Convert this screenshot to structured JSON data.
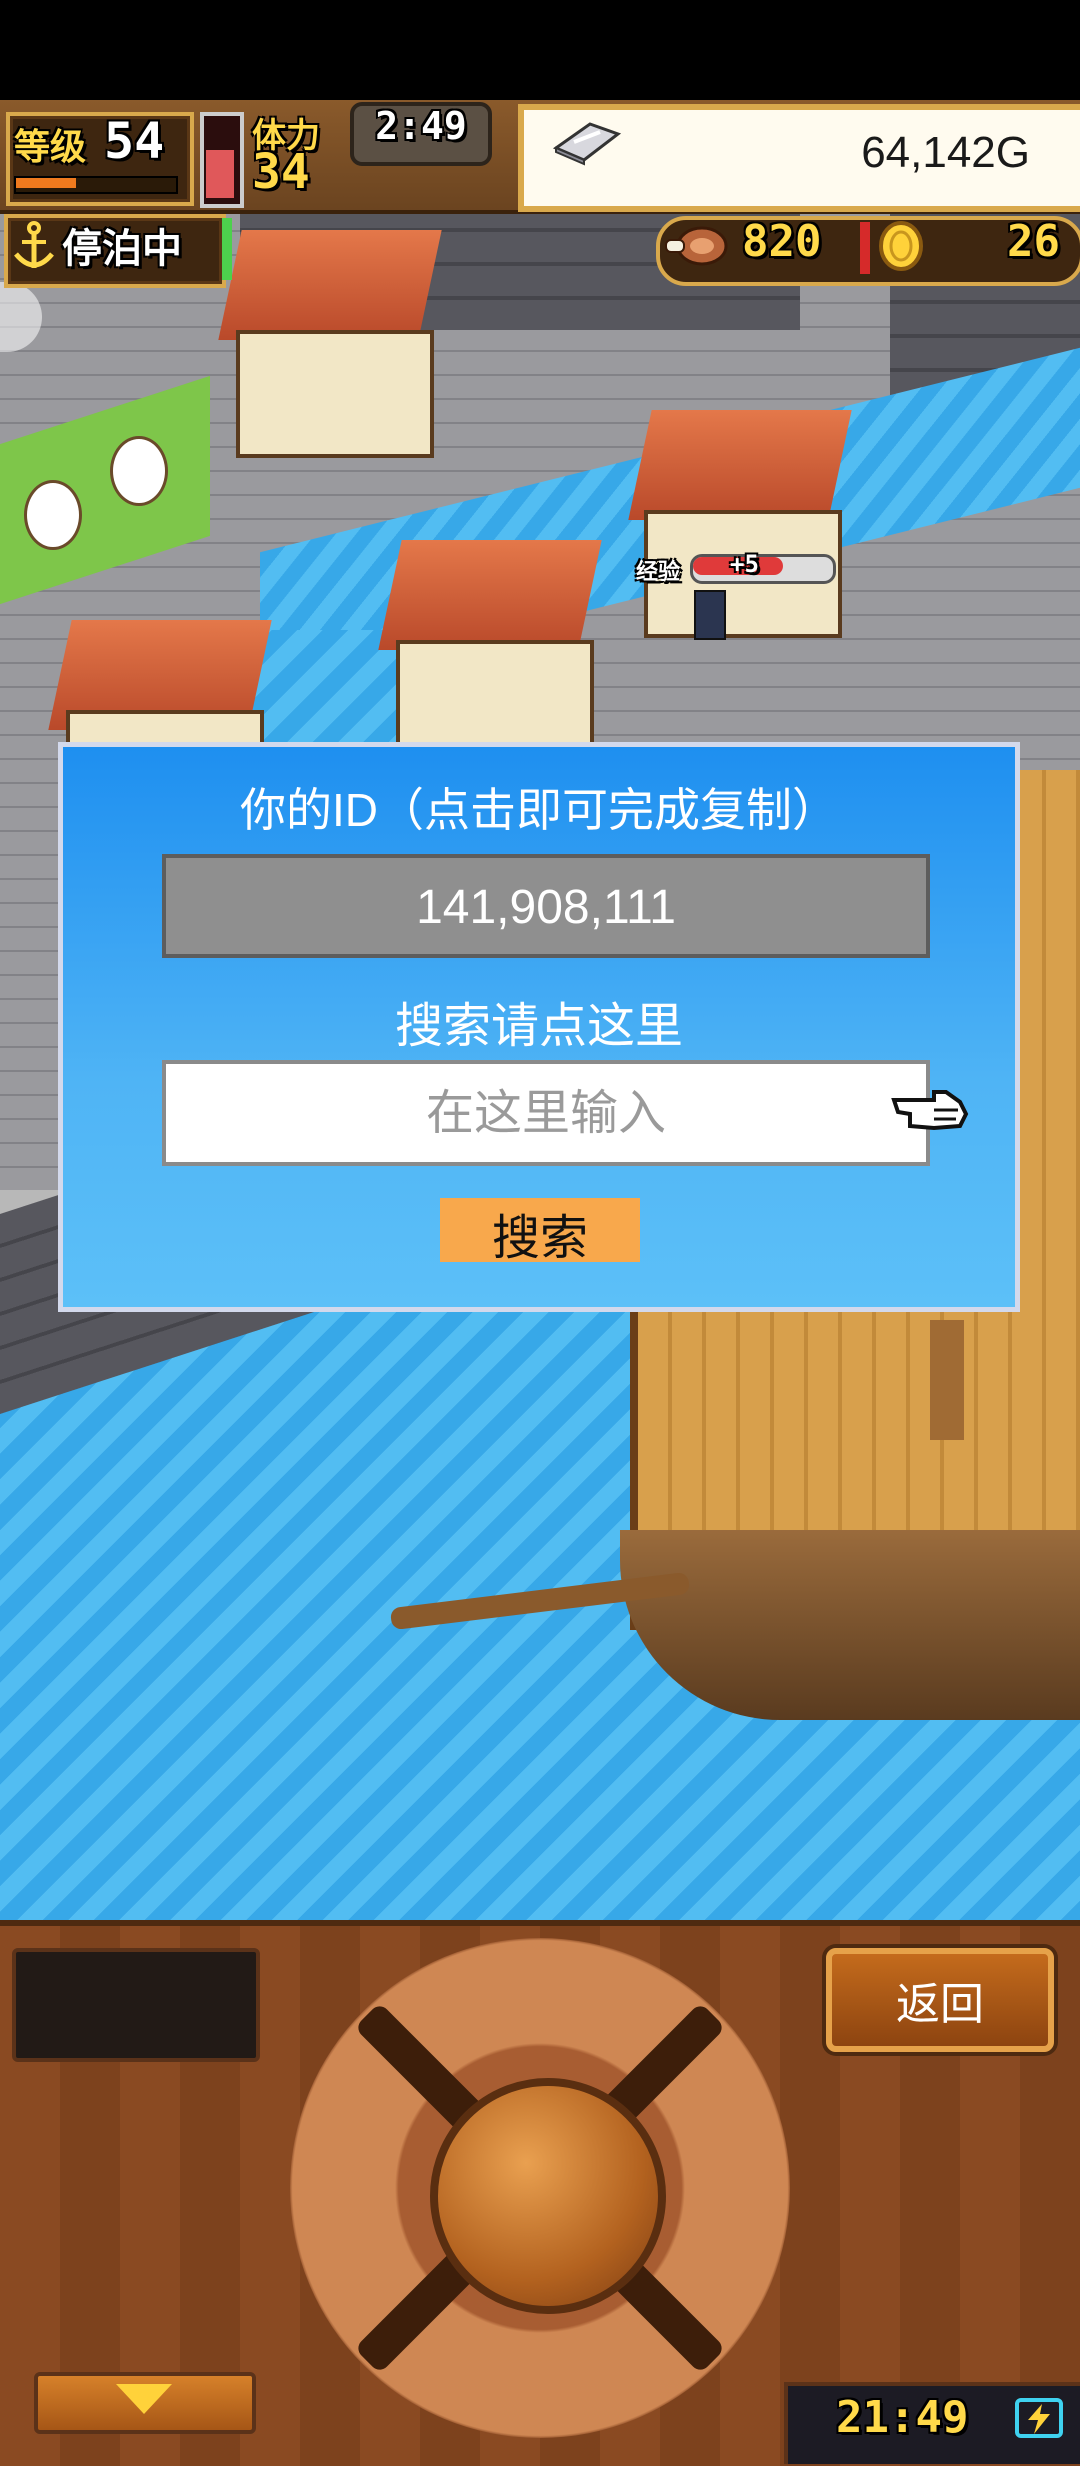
{
  "hud": {
    "level_label": "等级",
    "level_value": "54",
    "stamina_label": "体力",
    "stamina_value": "34",
    "stamina_timer": "2:49",
    "gold_value": "64,142G",
    "dock_label": "停泊中",
    "food_value": "820",
    "medal_value": "26"
  },
  "world": {
    "exp_label": "经验",
    "exp_gain": "+5"
  },
  "dialog": {
    "title": "你的ID（点击即可完成复制）",
    "id_value": "141,908,111",
    "search_hint": "搜索请点这里",
    "input_placeholder": "在这里输入",
    "search_button": "搜索"
  },
  "controls": {
    "back_button": "返回",
    "clock": "21:49"
  },
  "colors": {
    "dialog_blue": "#1e8ff0",
    "search_button": "#f8a84c",
    "id_box": "#8f8f8f"
  },
  "icons": [
    "anchor-icon",
    "silver-bar-icon",
    "meat-icon",
    "coin-icon",
    "pointer-hand-icon",
    "battery-charging-icon",
    "chevron-down-icon"
  ]
}
